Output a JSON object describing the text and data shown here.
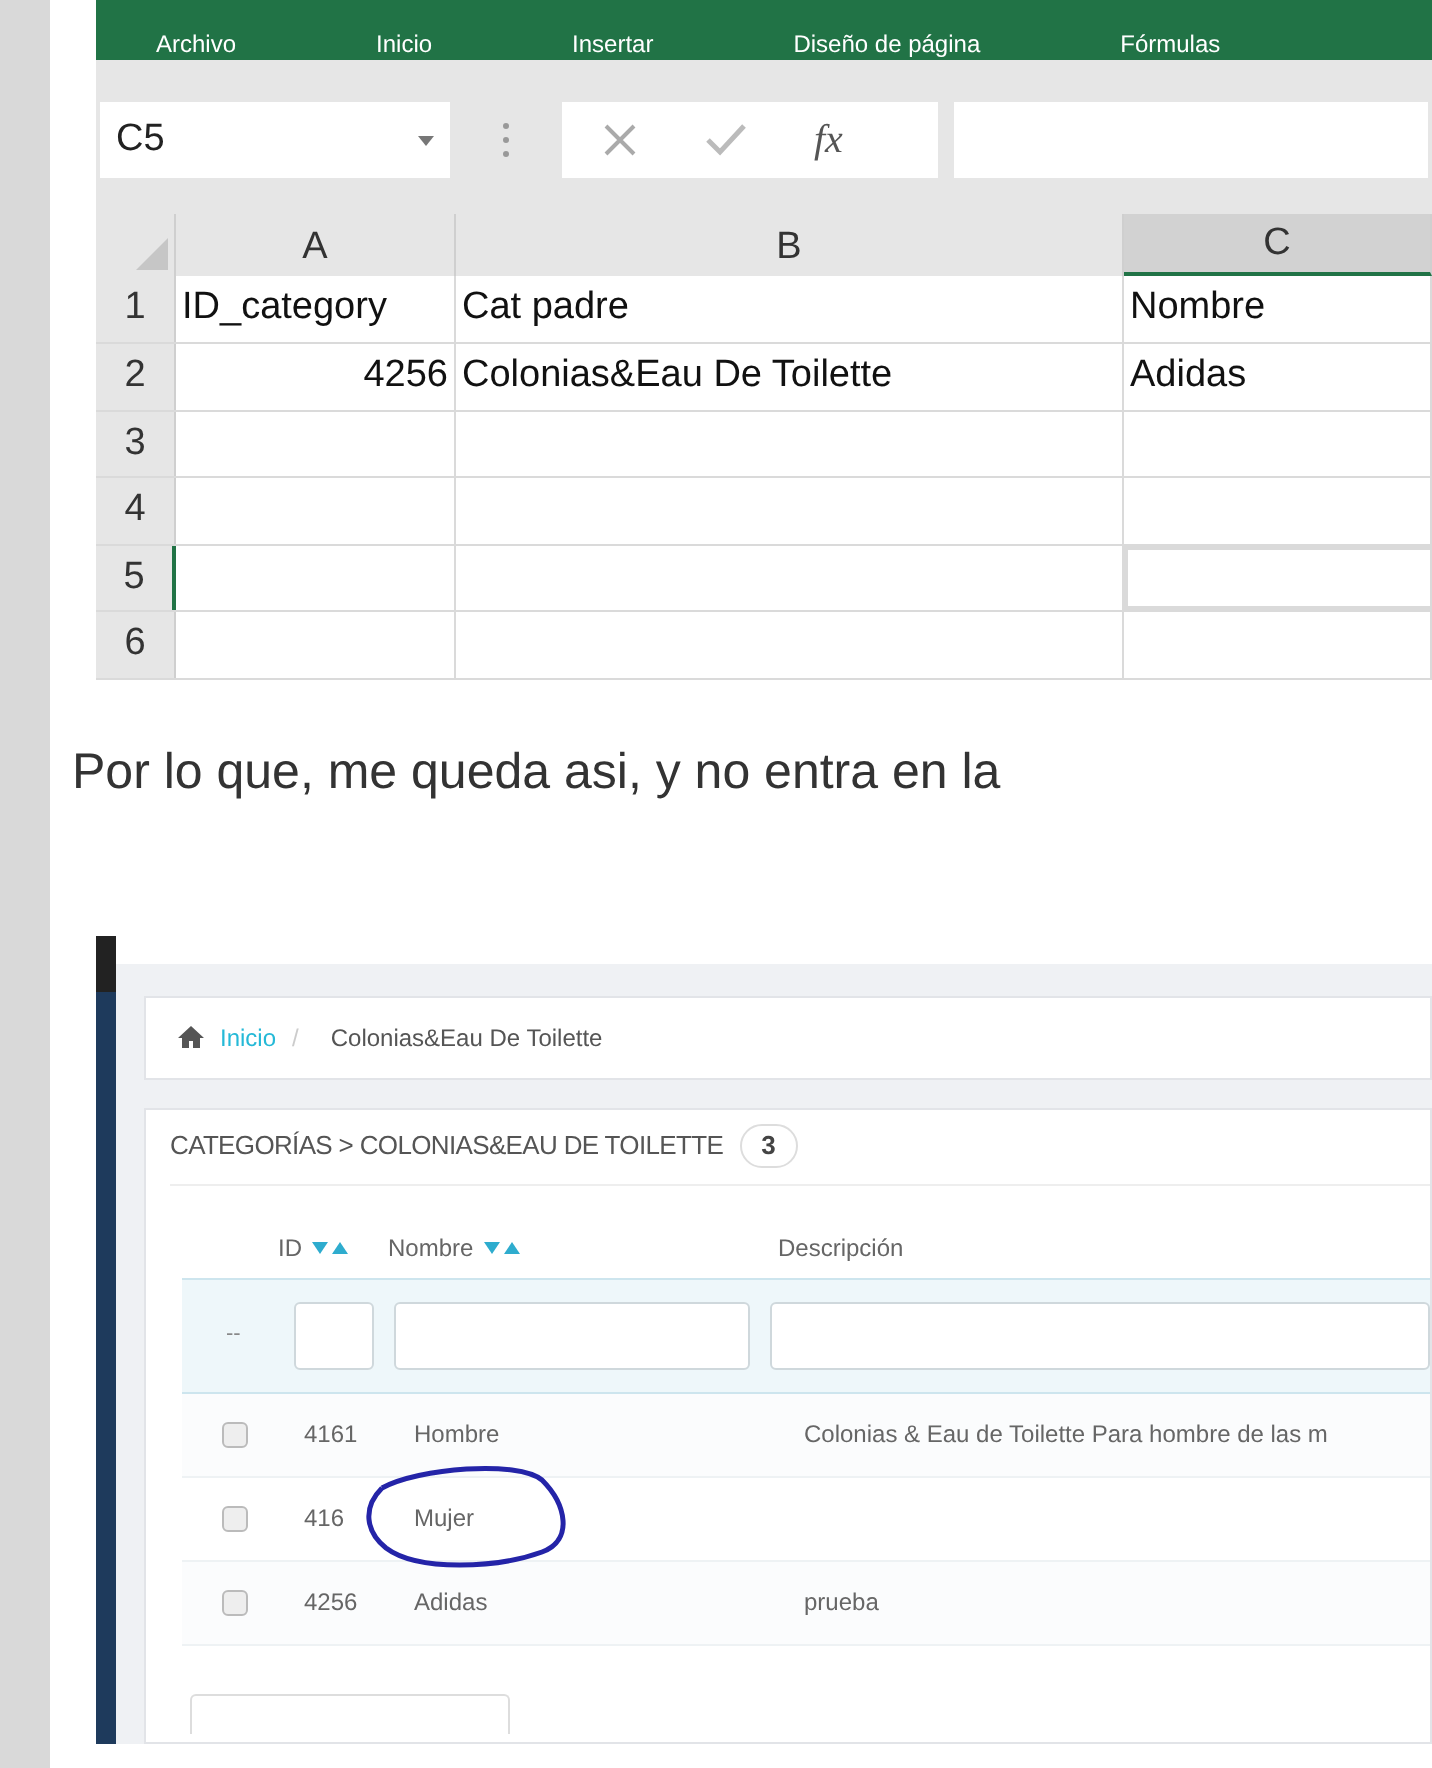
{
  "excel": {
    "ribbon_tabs": [
      "Archivo",
      "Inicio",
      "Insertar",
      "Diseño de página",
      "Fórmulas"
    ],
    "name_box": "C5",
    "fx": "fx",
    "columns": [
      {
        "label": "A",
        "selected": false
      },
      {
        "label": "B",
        "selected": false
      },
      {
        "label": "C",
        "selected": true
      }
    ],
    "rows": [
      {
        "label": "1",
        "selected": false,
        "cells": [
          {
            "text": "ID_category",
            "kind": "text"
          },
          {
            "text": "Cat padre",
            "kind": "text"
          },
          {
            "text": "Nombre",
            "kind": "text"
          }
        ]
      },
      {
        "label": "2",
        "selected": false,
        "cells": [
          {
            "text": "4256",
            "kind": "number"
          },
          {
            "text": "Colonias&Eau De Toilette",
            "kind": "text"
          },
          {
            "text": "Adidas",
            "kind": "text"
          }
        ]
      },
      {
        "label": "3",
        "selected": false,
        "cells": []
      },
      {
        "label": "4",
        "selected": false,
        "cells": []
      },
      {
        "label": "5",
        "selected": true,
        "cells": []
      },
      {
        "label": "6",
        "selected": false,
        "cells": []
      }
    ]
  },
  "paragraph": "Por lo que, me queda asi, y no entra en la",
  "admin": {
    "breadcrumb": {
      "home": "Inicio",
      "separator": "/",
      "current": "Colonias&Eau De Toilette"
    },
    "panel": {
      "title": "CATEGORÍAS > COLONIAS&EAU DE TOILETTE",
      "count": "3"
    },
    "columns": [
      "ID",
      "Nombre",
      "Descripción"
    ],
    "filter_reset": "--",
    "rows": [
      {
        "checked": false,
        "circled": false,
        "id": "4161",
        "name": "Hombre",
        "description": "Colonias & Eau de Toilette Para hombre de las m"
      },
      {
        "checked": false,
        "circled": true,
        "id": "416",
        "name": "Mujer"
      },
      {
        "checked": false,
        "circled": false,
        "id": "4256",
        "name": "Adidas",
        "description": "prueba"
      }
    ]
  }
}
